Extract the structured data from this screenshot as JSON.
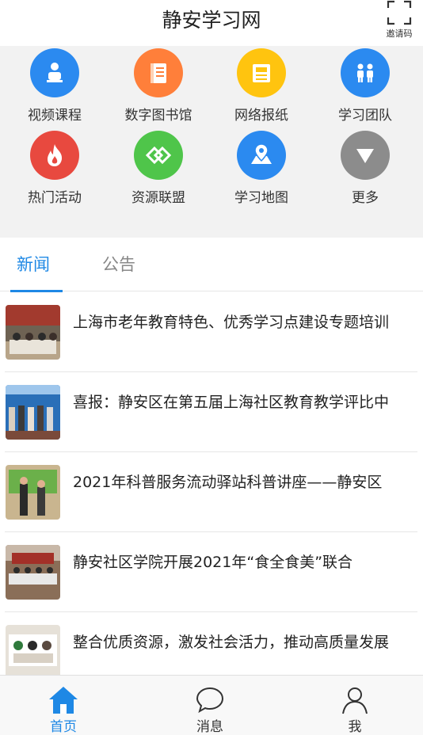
{
  "header": {
    "title": "静安学习网",
    "invite_label": "邀请码"
  },
  "grid": {
    "items": [
      {
        "label": "视频课程",
        "icon": "video-course-icon",
        "color": "#2b8af0"
      },
      {
        "label": "数字图书馆",
        "icon": "book-icon",
        "color": "#ff7f3a"
      },
      {
        "label": "网络报纸",
        "icon": "newspaper-icon",
        "color": "#ffc40f"
      },
      {
        "label": "学习团队",
        "icon": "team-icon",
        "color": "#2b8af0"
      },
      {
        "label": "热门活动",
        "icon": "fire-icon",
        "color": "#e8493f"
      },
      {
        "label": "资源联盟",
        "icon": "alliance-icon",
        "color": "#4fc54a"
      },
      {
        "label": "学习地图",
        "icon": "map-icon",
        "color": "#2b8af0"
      },
      {
        "label": "更多",
        "icon": "more-icon",
        "color": "#8c8c8c"
      }
    ]
  },
  "tabs": [
    {
      "label": "新闻",
      "active": true
    },
    {
      "label": "公告",
      "active": false
    }
  ],
  "news": [
    {
      "title": "上海市老年教育特色、优秀学习点建设专题培训"
    },
    {
      "title": "喜报：静安区在第五届上海社区教育教学评比中"
    },
    {
      "title": "2021年科普服务流动驿站科普讲座——静安区"
    },
    {
      "title": "静安社区学院开展2021年“食全食美”联合"
    },
    {
      "title": "整合优质资源，激发社会活力，推动高质量发展"
    }
  ],
  "bottom_nav": [
    {
      "label": "首页",
      "icon": "home-icon",
      "active": true
    },
    {
      "label": "消息",
      "icon": "message-icon",
      "active": false
    },
    {
      "label": "我",
      "icon": "user-icon",
      "active": false
    }
  ],
  "colors": {
    "accent": "#1e88e5"
  }
}
